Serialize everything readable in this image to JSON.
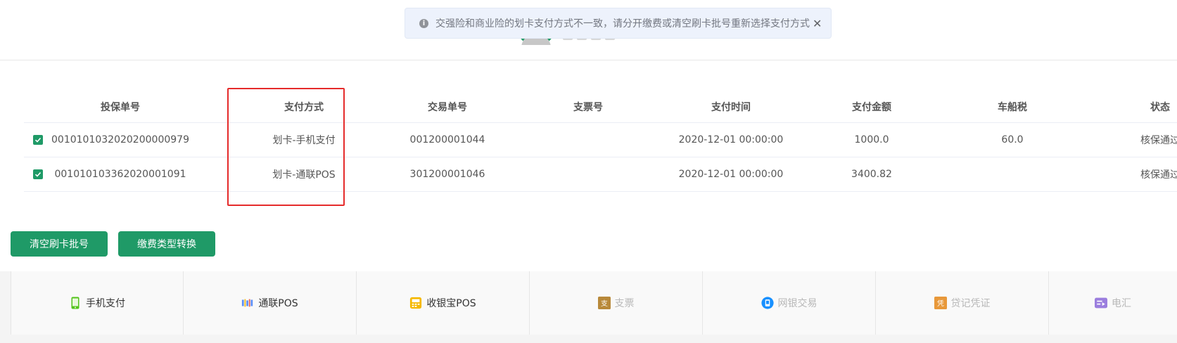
{
  "toast": {
    "message": "交强险和商业险的划卡支付方式不一致，请分开缴费或清空刷卡批号重新选择支付方式",
    "close": "✕"
  },
  "table": {
    "headers": [
      "投保单号",
      "支付方式",
      "交易单号",
      "支票号",
      "支付时间",
      "支付金额",
      "车船税",
      "状态"
    ],
    "rows": [
      {
        "checked": true,
        "policy_no": "0010101032020200000979",
        "pay_method": "划卡-手机支付",
        "trade_no": "001200001044",
        "check_no": "",
        "pay_time": "2020-12-01 00:00:00",
        "amount": "1000.0",
        "vehicle_tax": "60.0",
        "status": "核保通过"
      },
      {
        "checked": true,
        "policy_no": "001010103362020001091",
        "pay_method": "划卡-通联POS",
        "trade_no": "301200001046",
        "check_no": "",
        "pay_time": "2020-12-01 00:00:00",
        "amount": "3400.82",
        "vehicle_tax": "",
        "status": "核保通过"
      }
    ]
  },
  "buttons": {
    "clear": "清空刷卡批号",
    "convert": "缴费类型转换"
  },
  "payment_methods": [
    {
      "label": "手机支付",
      "icon": "phone-icon",
      "enabled": true
    },
    {
      "label": "通联POS",
      "icon": "card-reader-icon",
      "enabled": true
    },
    {
      "label": "收银宝POS",
      "icon": "pos-terminal-icon",
      "enabled": true
    },
    {
      "label": "支票",
      "icon": "check-icon",
      "enabled": false
    },
    {
      "label": "网银交易",
      "icon": "bank-icon",
      "enabled": false
    },
    {
      "label": "贷记凭证",
      "icon": "voucher-icon",
      "enabled": false
    },
    {
      "label": "电汇",
      "icon": "wire-transfer-icon",
      "enabled": false
    }
  ],
  "colors": {
    "primary": "#1f9a67",
    "highlight": "#e52b2b",
    "toast_bg": "#edf2fc"
  }
}
